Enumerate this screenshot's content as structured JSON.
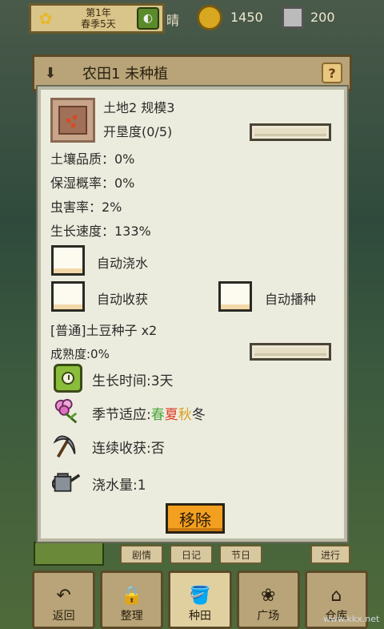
{
  "hud": {
    "year_label": "第1年",
    "season_day": "春季5天",
    "weather": "晴",
    "gold": "1450",
    "gems": "200",
    "icons": [
      "flower-icon",
      "clock-icon",
      "coin-icon",
      "card-icon"
    ]
  },
  "field_bar": {
    "title": "农田1  未种植",
    "help": "?"
  },
  "panel": {
    "land_title": "土地2 规模3",
    "cultivation_label": "开垦度(0/5)",
    "cultivation_fraction": 0,
    "soil_quality": "土壤品质：0%",
    "moisture": "保湿概率：0%",
    "pest_rate": "虫害率：2%",
    "growth_speed": "生长速度：133%",
    "auto_water": "自动浇水",
    "auto_harvest": "自动收获",
    "auto_sow": "自动播种",
    "seed_name": "[普通]土豆种子 x2",
    "maturity_label": "成熟度:0%",
    "maturity_fraction": 0,
    "growth_time": "生长时间:3天",
    "season_prefix": "季节适应:",
    "seasons": [
      {
        "name": "春",
        "color": "#4aa83a"
      },
      {
        "name": "夏",
        "color": "#e0402a"
      },
      {
        "name": "秋",
        "color": "#d8a020"
      },
      {
        "name": "冬",
        "color": "#2a2a2a"
      }
    ],
    "continuous_harvest": "连续收获:否",
    "water_amount": "浇水量:1",
    "remove_button": "移除"
  },
  "bottom": {
    "small_tabs": [
      "剧情",
      "日记",
      "节日"
    ],
    "progress_tab": "进行",
    "nav": [
      {
        "label": "返回",
        "icon": "↶"
      },
      {
        "label": "整理",
        "icon": "🔒"
      },
      {
        "label": "种田",
        "icon": "🪣"
      },
      {
        "label": "广场",
        "icon": "❀"
      },
      {
        "label": "仓库",
        "icon": "⌂"
      }
    ]
  },
  "watermark": "www.kkx.net",
  "colors": {
    "accent": "#f3a020",
    "panel_bg": "#ececde",
    "bar_fill": "#6aa83a"
  }
}
